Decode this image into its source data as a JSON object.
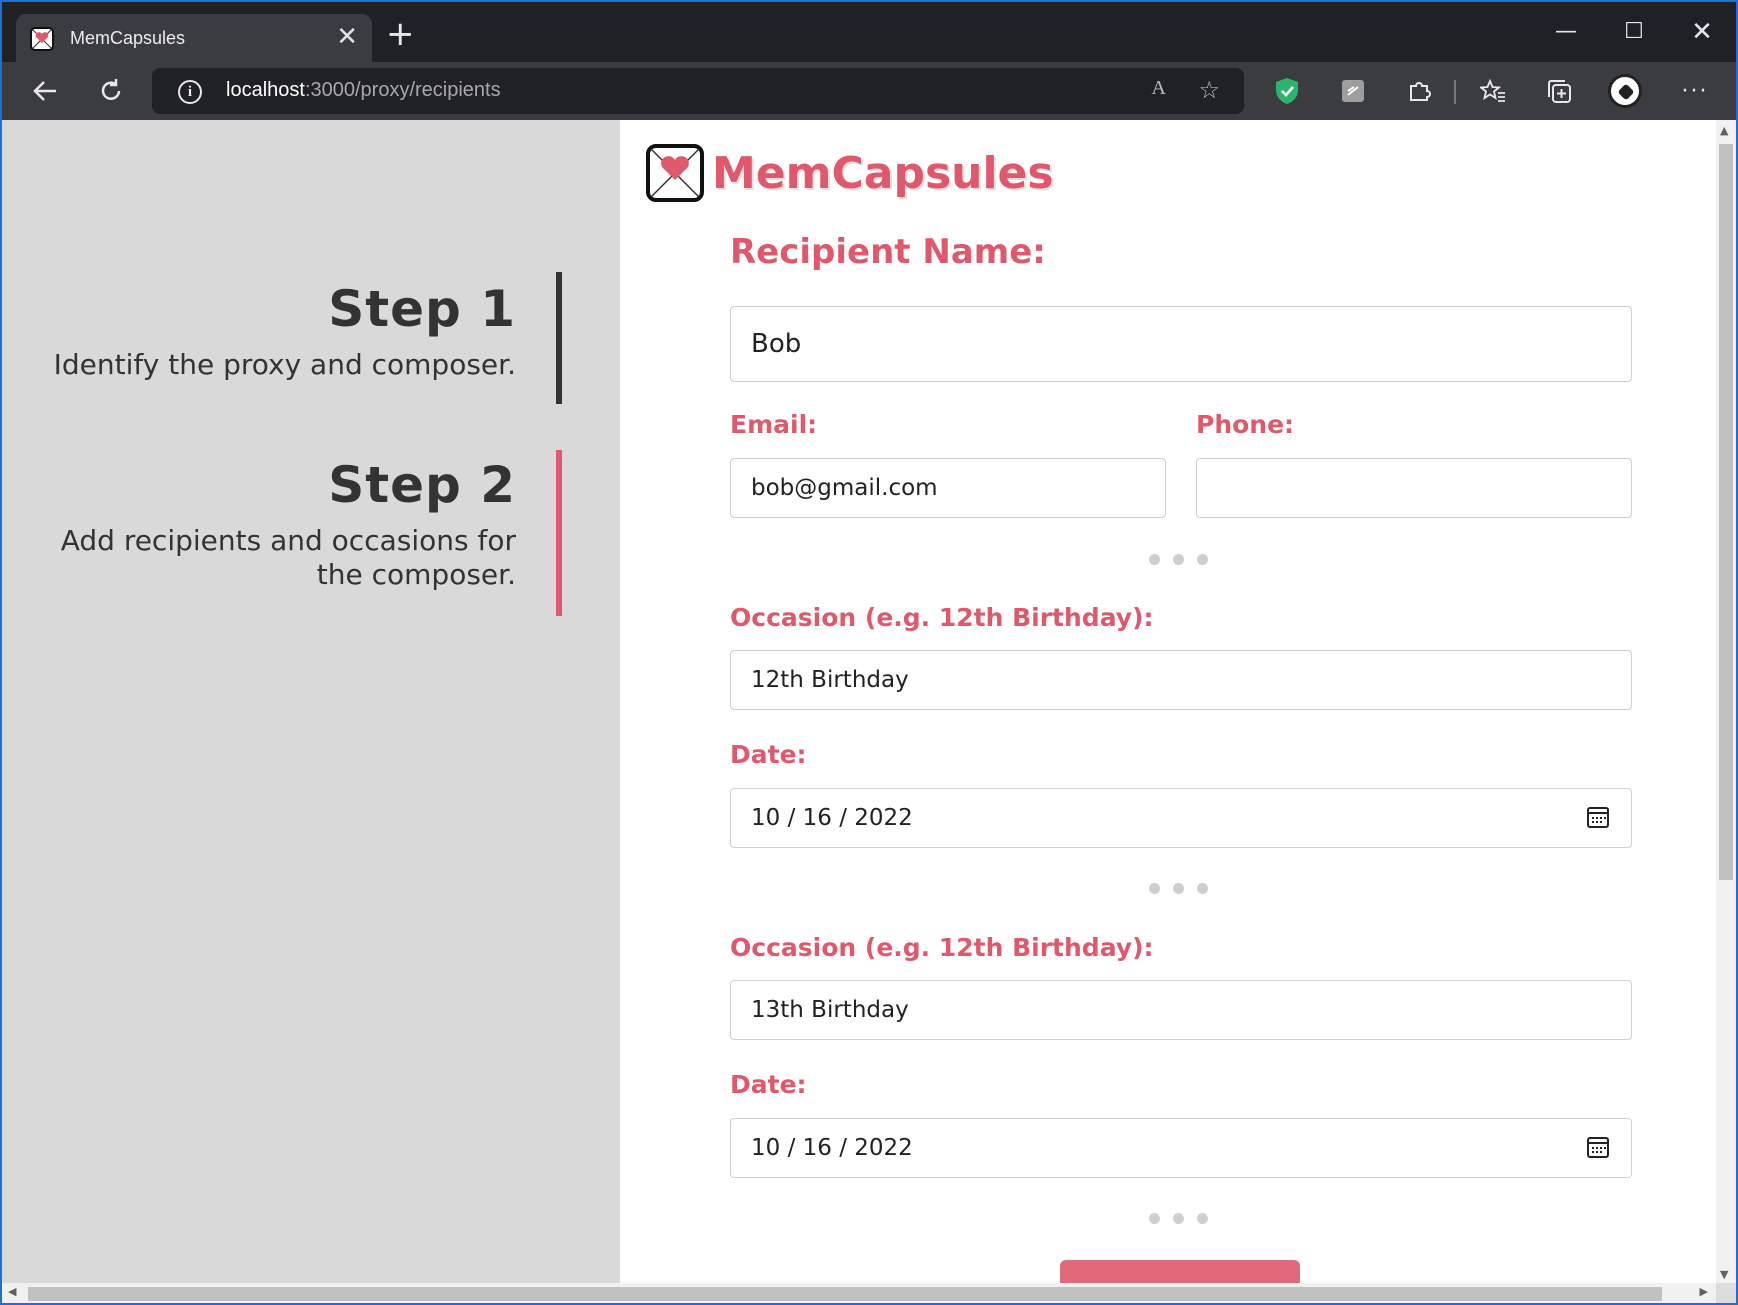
{
  "browser": {
    "tab_title": "MemCapsules",
    "tab_close": "✕",
    "new_tab": "+",
    "url_host": "localhost",
    "url_rest": ":3000/proxy/recipients",
    "read_aloud": "A",
    "window_min": "—",
    "window_max": "☐",
    "window_close": "✕"
  },
  "sidebar": {
    "steps": [
      {
        "title": "Step 1",
        "description": "Identify the proxy and composer."
      },
      {
        "title": "Step 2",
        "description": "Add recipients and occasions for the composer."
      }
    ]
  },
  "brand": {
    "name": "MemCapsules",
    "accent_color": "#e0586b"
  },
  "form": {
    "recipient_name_label": "Recipient Name:",
    "recipient_name_value": "Bob",
    "email_label": "Email:",
    "email_value": "bob@gmail.com",
    "phone_label": "Phone:",
    "phone_value": "",
    "occasions": [
      {
        "occasion_label": "Occasion (e.g. 12th Birthday):",
        "occasion_value": "12th Birthday",
        "date_label": "Date:",
        "date_value": "10 / 16 / 2022"
      },
      {
        "occasion_label": "Occasion (e.g. 12th Birthday):",
        "occasion_value": "13th Birthday",
        "date_label": "Date:",
        "date_value": "10 / 16 / 2022"
      }
    ]
  },
  "icons": {
    "back": "back-arrow-icon",
    "refresh": "refresh-icon",
    "info": "info-icon",
    "favorite_add": "star-plus-icon",
    "shield": "shield-check-icon",
    "extension": "puzzle-icon",
    "favorites": "favorites-icon",
    "collections": "collections-icon",
    "profile": "soccer-ball-icon",
    "more": "more-icon",
    "calendar": "calendar-icon"
  }
}
